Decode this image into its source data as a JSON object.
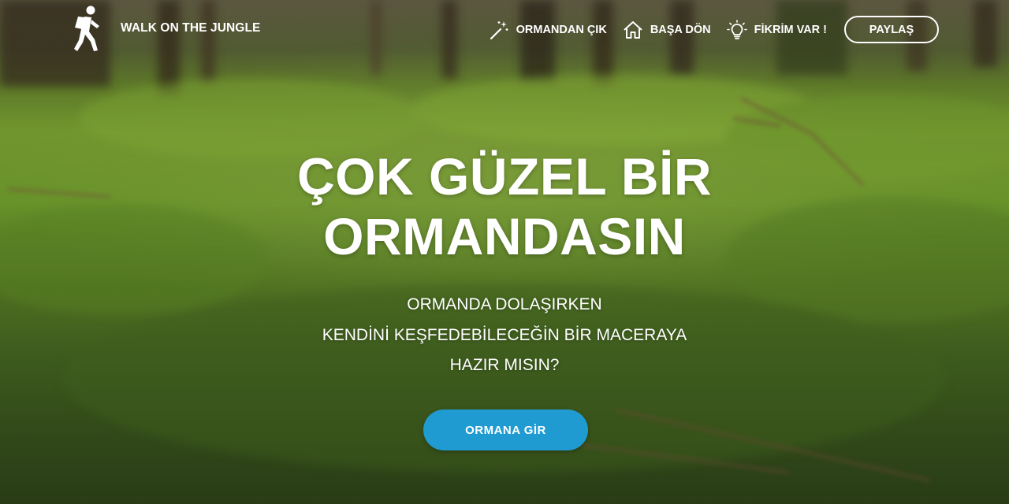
{
  "brand": {
    "name": "WALK ON THE JUNGLE",
    "icon": "hiker-icon"
  },
  "nav": {
    "items": [
      {
        "label": "ORMANDAN ÇIK",
        "icon": "magic-wand-icon"
      },
      {
        "label": "BAŞA DÖN",
        "icon": "home-icon"
      },
      {
        "label": "FİKRİM VAR !",
        "icon": "lightbulb-icon"
      }
    ],
    "share_label": "PAYLAŞ"
  },
  "hero": {
    "headline": "ÇOK GÜZEL BİR ORMANDASIN",
    "subtitle_lines": [
      "ORMANDA DOLAŞIRKEN",
      "KENDİNİ KEŞFEDEBİLECEĞİN BİR MACERAYA",
      "HAZIR MISIN?"
    ],
    "cta_label": "ORMANA GİR"
  },
  "colors": {
    "accent": "#1f9bd1",
    "text": "#ffffff",
    "forest_moss": "#6d9a2c"
  }
}
